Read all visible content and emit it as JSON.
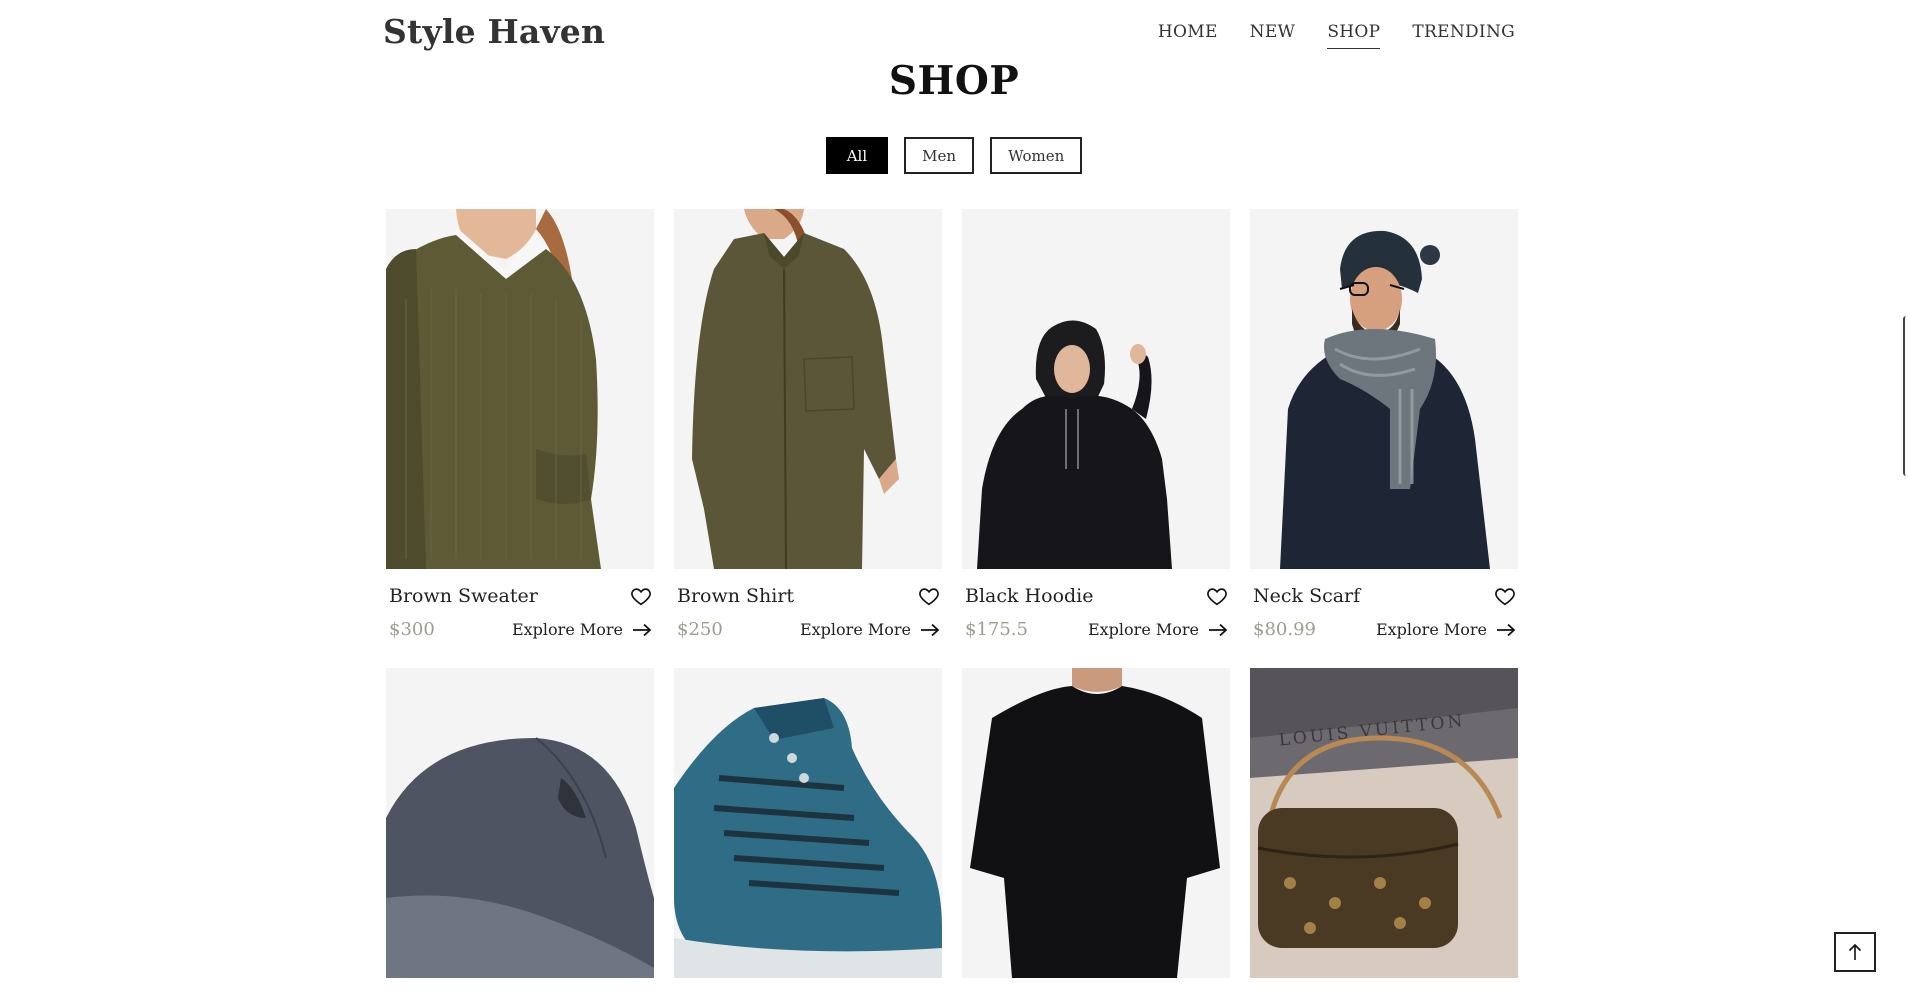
{
  "brand": {
    "name": "Style Haven"
  },
  "nav": {
    "items": [
      {
        "label": "HOME",
        "active": false
      },
      {
        "label": "NEW",
        "active": false
      },
      {
        "label": "SHOP",
        "active": true
      },
      {
        "label": "TRENDING",
        "active": false
      }
    ]
  },
  "page": {
    "title": "SHOP"
  },
  "filters": {
    "all": "All",
    "men": "Men",
    "women": "Women",
    "selected": "All"
  },
  "products": [
    {
      "name": "Brown Sweater",
      "price": "$300",
      "cta": "Explore More"
    },
    {
      "name": "Brown Shirt",
      "price": "$250",
      "cta": "Explore More"
    },
    {
      "name": "Black Hoodie",
      "price": "$175.5",
      "cta": "Explore More"
    },
    {
      "name": "Neck Scarf",
      "price": "$80.99",
      "cta": "Explore More"
    },
    {
      "name": "",
      "price": "",
      "cta": ""
    },
    {
      "name": "",
      "price": "",
      "cta": ""
    },
    {
      "name": "",
      "price": "",
      "cta": ""
    },
    {
      "name": "",
      "price": "",
      "cta": ""
    }
  ],
  "bag_logo_text": "LOUIS VUITTON",
  "colors": {
    "accent": "#000000",
    "price": "#9aa08e",
    "thumb_bg": "#f4f4f4"
  }
}
